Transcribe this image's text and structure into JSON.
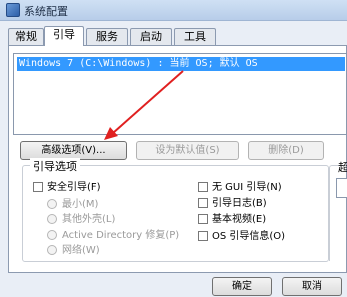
{
  "window": {
    "title": "系统配置"
  },
  "tabs": [
    {
      "label": "常规"
    },
    {
      "label": "引导"
    },
    {
      "label": "服务"
    },
    {
      "label": "启动"
    },
    {
      "label": "工具"
    }
  ],
  "boot_entries": [
    "Windows 7 (C:\\Windows) : 当前 OS; 默认 OS"
  ],
  "buttons": {
    "advanced": "高级选项(V)...",
    "set_default": "设为默认值(S)",
    "delete": "删除(D)",
    "ok": "确定",
    "cancel": "取消"
  },
  "boot_options": {
    "title": "引导选项",
    "safe_boot": "安全引导(F)",
    "minimal": "最小(M)",
    "alternate_shell": "其他外壳(L)",
    "active_directory": "Active Directory 修复(P)",
    "network": "网络(W)",
    "no_gui": "无 GUI 引导(N)",
    "boot_log": "引导日志(B)",
    "base_video": "基本视频(E)",
    "os_info": "OS 引导信息(O)"
  },
  "right_partial_label": "超",
  "colors": {
    "selection": "#3399ff",
    "annotation_arrow": "#e02020"
  }
}
